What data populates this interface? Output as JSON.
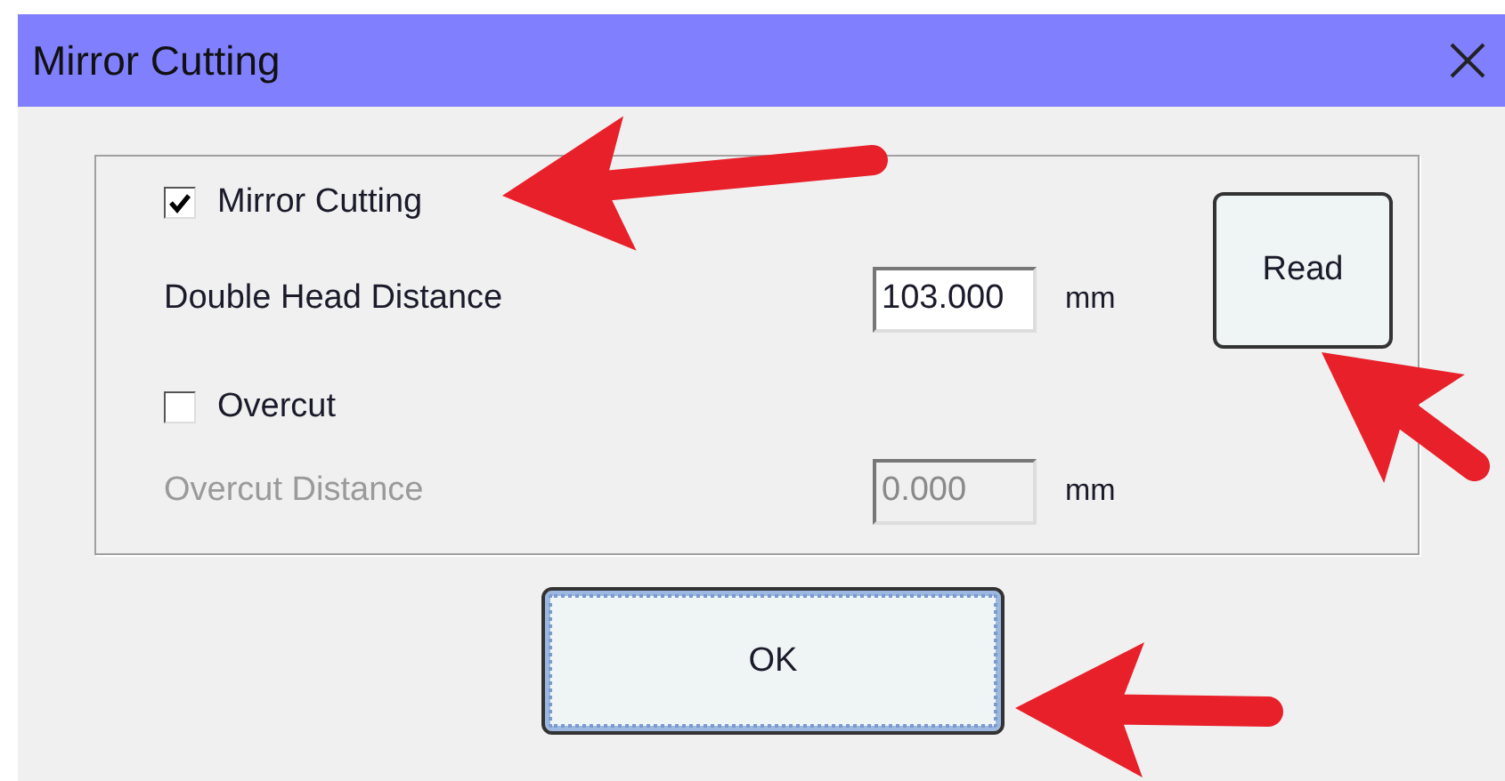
{
  "window": {
    "title": "Mirror Cutting"
  },
  "options": [
    {
      "kind": "checkbox",
      "label": "Mirror Cutting",
      "checked": true
    },
    {
      "kind": "number",
      "label": "Double Head Distance",
      "value": "103.000",
      "unit": "mm",
      "disabled": false
    },
    {
      "kind": "checkbox",
      "label": "Overcut",
      "checked": false
    },
    {
      "kind": "number",
      "label": "Overcut Distance",
      "value": "0.000",
      "unit": "mm",
      "disabled": true
    }
  ],
  "buttons": [
    {
      "label": "Read",
      "focused": false
    },
    {
      "label": "OK",
      "focused": true
    }
  ]
}
